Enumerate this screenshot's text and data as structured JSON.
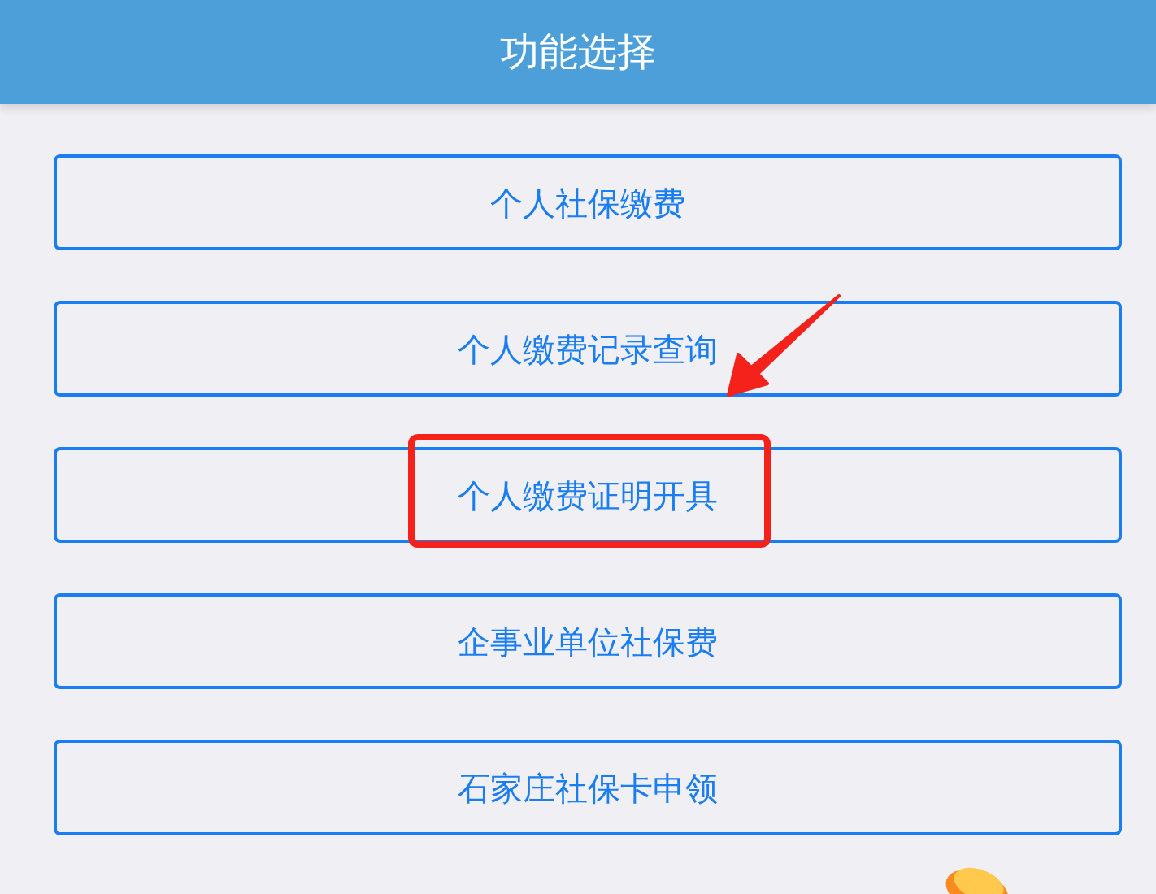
{
  "header": {
    "title": "功能选择"
  },
  "menu_items": [
    {
      "label": "个人社保缴费",
      "highlighted": false
    },
    {
      "label": "个人缴费记录查询",
      "highlighted": false
    },
    {
      "label": "个人缴费证明开具",
      "highlighted": true
    },
    {
      "label": "企事业单位社保费",
      "highlighted": false
    },
    {
      "label": "石家庄社保卡申领",
      "highlighted": false
    }
  ]
}
